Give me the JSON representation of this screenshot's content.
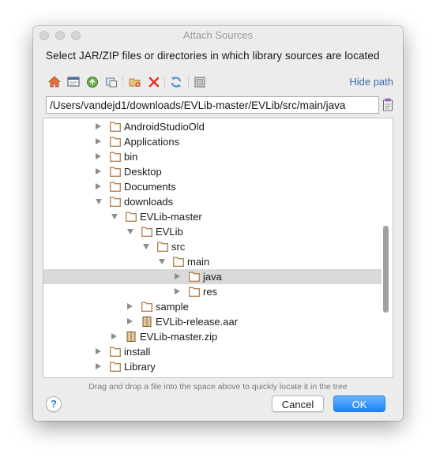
{
  "window": {
    "title": "Attach Sources",
    "instruction": "Select JAR/ZIP files or directories in which library sources are located"
  },
  "toolbar": {
    "hide_path_label": "Hide path",
    "icons": [
      "home-icon",
      "desktop-icon",
      "project-icon",
      "module-icon",
      "new-folder-icon",
      "delete-icon",
      "refresh-icon",
      "show-hidden-icon"
    ]
  },
  "path": {
    "value": "/Users/vandejd1/downloads/EVLib-master/EVLib/src/main/java"
  },
  "tree": {
    "items": [
      {
        "label": "AndroidStudioOld",
        "type": "folder",
        "expanded": false,
        "depth": 0
      },
      {
        "label": "Applications",
        "type": "folder",
        "expanded": false,
        "depth": 0
      },
      {
        "label": "bin",
        "type": "folder",
        "expanded": false,
        "depth": 0
      },
      {
        "label": "Desktop",
        "type": "folder",
        "expanded": false,
        "depth": 0
      },
      {
        "label": "Documents",
        "type": "folder",
        "expanded": false,
        "depth": 0
      },
      {
        "label": "downloads",
        "type": "folder",
        "expanded": true,
        "depth": 0
      },
      {
        "label": "EVLib-master",
        "type": "folder",
        "expanded": true,
        "depth": 1
      },
      {
        "label": "EVLib",
        "type": "folder",
        "expanded": true,
        "depth": 2
      },
      {
        "label": "src",
        "type": "folder",
        "expanded": true,
        "depth": 3
      },
      {
        "label": "main",
        "type": "folder",
        "expanded": true,
        "depth": 4
      },
      {
        "label": "java",
        "type": "folder",
        "expanded": false,
        "depth": 5,
        "selected": true
      },
      {
        "label": "res",
        "type": "folder",
        "expanded": false,
        "depth": 5
      },
      {
        "label": "sample",
        "type": "folder",
        "expanded": false,
        "depth": 2
      },
      {
        "label": "EVLib-release.aar",
        "type": "archive",
        "expanded": false,
        "depth": 2
      },
      {
        "label": "EVLib-master.zip",
        "type": "archive",
        "expanded": false,
        "depth": 1
      },
      {
        "label": "install",
        "type": "folder",
        "expanded": false,
        "depth": 0
      },
      {
        "label": "Library",
        "type": "folder",
        "expanded": false,
        "depth": 0
      }
    ]
  },
  "hint": "Drag and drop a file into the space above to quickly locate it in the tree",
  "buttons": {
    "help": "?",
    "cancel": "Cancel",
    "ok": "OK"
  },
  "colors": {
    "accent": "#1a82fb",
    "folder": "#b2885a",
    "selection": "#d9d9d9",
    "link": "#3e6aa9"
  }
}
